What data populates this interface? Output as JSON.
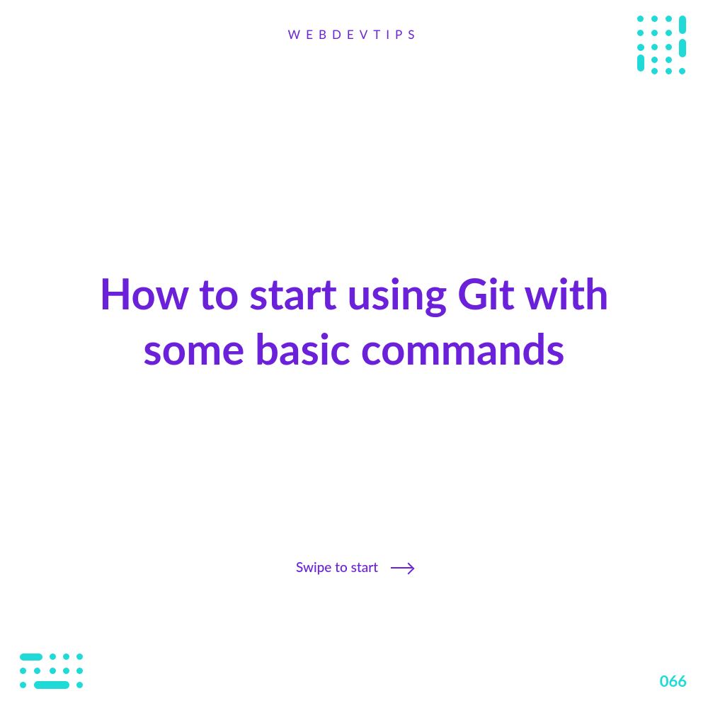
{
  "header": {
    "brand": "WEBDEVTIPS"
  },
  "main": {
    "title": "How to start using Git with some basic commands",
    "swipe_label": "Swipe to start"
  },
  "footer": {
    "page_number": "066"
  },
  "colors": {
    "accent": "#6B21D9",
    "decoration": "#1FDAD6"
  }
}
